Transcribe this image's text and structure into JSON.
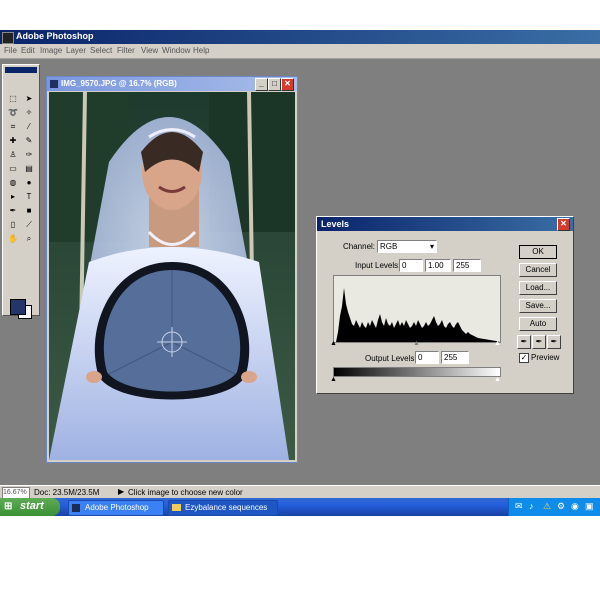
{
  "app": {
    "title": "Adobe Photoshop"
  },
  "menu": [
    "File",
    "Edit",
    "Image",
    "Layer",
    "Select",
    "Filter",
    "View",
    "Window",
    "Help"
  ],
  "colors": {
    "accent": "#0a246a",
    "workspace": "#7f7f7f",
    "foreground_swatch": "#22366a",
    "background_swatch": "#ffffff"
  },
  "document": {
    "title": "IMG_9570.JPG @ 16.7% (RGB)"
  },
  "levels": {
    "title": "Levels",
    "channel_label": "Channel:",
    "channel_value": "RGB",
    "input_label": "Input Levels:",
    "input_values": [
      "0",
      "1.00",
      "255"
    ],
    "output_label": "Output Levels:",
    "output_values": [
      "0",
      "255"
    ],
    "buttons": {
      "ok": "OK",
      "cancel": "Cancel",
      "load": "Load...",
      "save": "Save...",
      "auto": "Auto"
    },
    "preview_label": "Preview",
    "preview_checked": true
  },
  "status": {
    "zoom": "16.67%",
    "doc": "Doc: 23.5M/23.5M",
    "hint": "Click image to choose new color"
  },
  "taskbar": {
    "start": "start",
    "items": [
      "Adobe Photoshop",
      "Ezybalance sequences"
    ]
  }
}
